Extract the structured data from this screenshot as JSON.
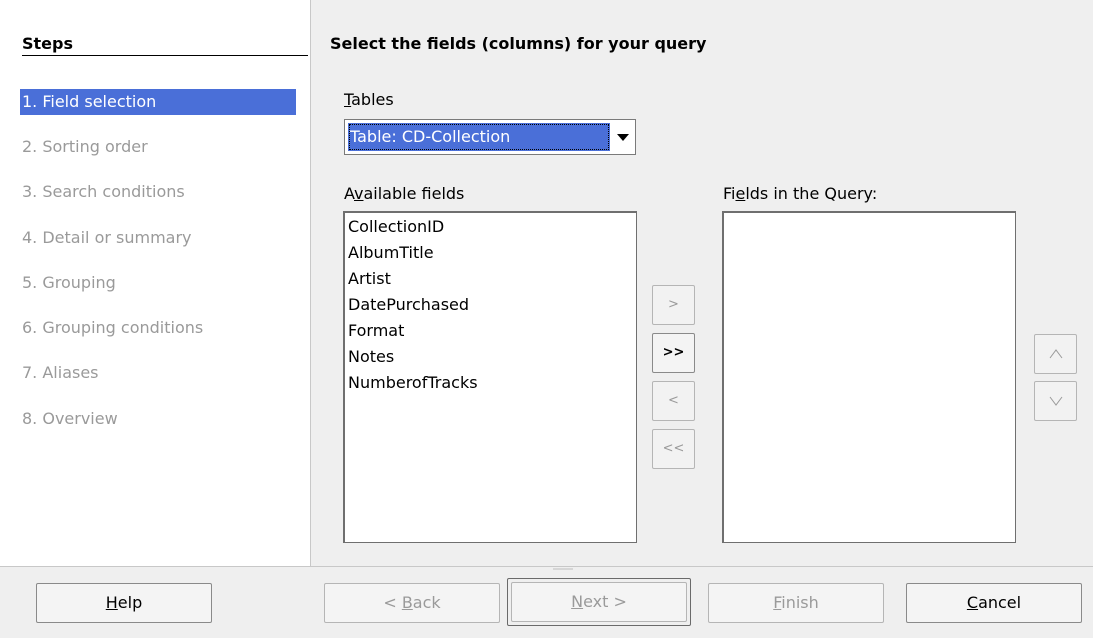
{
  "steps": {
    "title": "Steps",
    "items": [
      {
        "label": "1. Field selection"
      },
      {
        "label": "2. Sorting order"
      },
      {
        "label": "3. Search conditions"
      },
      {
        "label": "4. Detail or summary"
      },
      {
        "label": "5. Grouping"
      },
      {
        "label": "6. Grouping conditions"
      },
      {
        "label": "7. Aliases"
      },
      {
        "label": "8. Overview"
      }
    ]
  },
  "main": {
    "title": "Select the fields (columns) for your query",
    "tables": {
      "label_mnemonic": "T",
      "label_rest": "ables",
      "selected": "Table: CD-Collection"
    },
    "available": {
      "label_pre": "A",
      "label_mnemonic": "v",
      "label_rest": "ailable fields",
      "items": [
        "CollectionID",
        "AlbumTitle",
        "Artist",
        "DatePurchased",
        "Format",
        "Notes",
        "NumberofTracks"
      ]
    },
    "query": {
      "label_pre": "Fi",
      "label_mnemonic": "e",
      "label_rest": "lds in the Query:"
    },
    "move_buttons": {
      "add": ">",
      "add_all": ">>",
      "remove": "<",
      "remove_all": "<<"
    },
    "order_buttons": {
      "up": "^",
      "down": "v"
    }
  },
  "footer": {
    "help": {
      "mnemonic": "H",
      "rest": "elp"
    },
    "back": {
      "pre": "< ",
      "mnemonic": "B",
      "rest": "ack"
    },
    "next": {
      "mnemonic": "N",
      "rest": "ext >"
    },
    "finish": {
      "mnemonic": "F",
      "rest": "inish"
    },
    "cancel": {
      "mnemonic": "C",
      "rest": "ancel"
    }
  },
  "colors": {
    "selection": "#4a6fd8",
    "disabled_text": "#9a9a9a",
    "background": "#efefef"
  }
}
